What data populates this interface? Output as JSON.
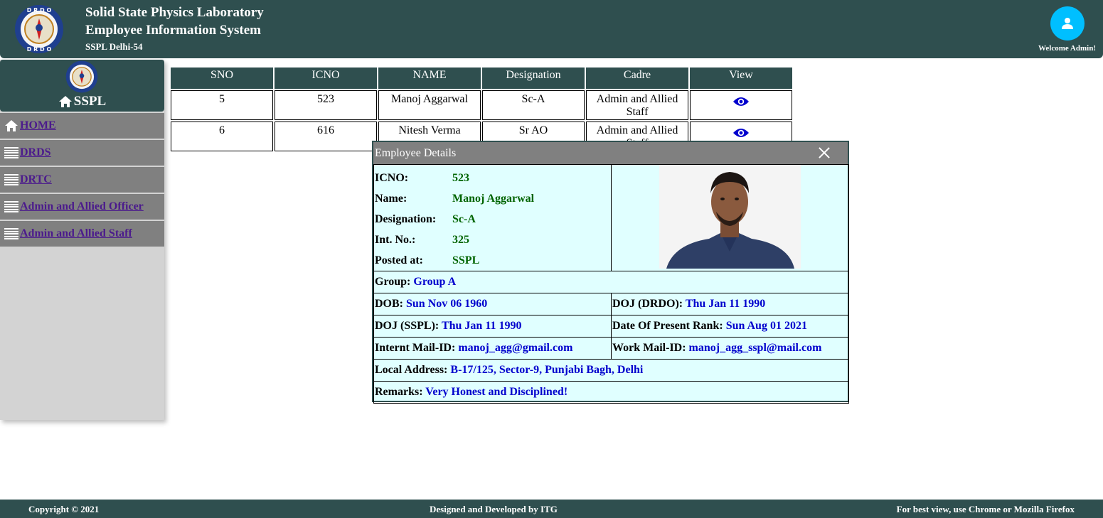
{
  "header": {
    "title_line1": "Solid State Physics Laboratory",
    "title_line2": "Employee Information System",
    "subtitle": "SSPL Delhi-54",
    "welcome": "Welcome Admin!",
    "logo_icon": "drdo-logo-icon",
    "user_icon": "user-icon"
  },
  "sidebar": {
    "title": "SSPL",
    "items": [
      {
        "label": "HOME",
        "icon": "home-icon"
      },
      {
        "label": "DRDS",
        "icon": "menu-icon"
      },
      {
        "label": "DRTC",
        "icon": "menu-icon"
      },
      {
        "label": "Admin and Allied Officer",
        "icon": "menu-icon"
      },
      {
        "label": "Admin and Allied Staff",
        "icon": "menu-icon"
      }
    ]
  },
  "table": {
    "headers": [
      "SNO",
      "ICNO",
      "NAME",
      "Designation",
      "Cadre",
      "View"
    ],
    "rows": [
      {
        "sno": "5",
        "icno": "523",
        "name": "Manoj Aggarwal",
        "designation": "Sc-A",
        "cadre": "Admin and Allied Staff"
      },
      {
        "sno": "6",
        "icno": "616",
        "name": "Nitesh Verma",
        "designation": "Sr AO",
        "cadre": "Admin and Allied Staff"
      }
    ]
  },
  "modal": {
    "title": "Employee Details",
    "icno_label": "ICNO:",
    "icno": "523",
    "name_label": "Name:",
    "name": "Manoj Aggarwal",
    "designation_label": "Designation:",
    "designation": "Sc-A",
    "intno_label": "Int. No.:",
    "intno": "325",
    "posted_label": "Posted at:",
    "posted": "SSPL",
    "group_label": "Group:",
    "group": "Group A",
    "dob_label": "DOB:",
    "dob": "Sun Nov 06 1960",
    "doj_drdo_label": "DOJ (DRDO):",
    "doj_drdo": "Thu Jan 11 1990",
    "doj_sspl_label": "DOJ (SSPL):",
    "doj_sspl": "Thu Jan 11 1990",
    "present_rank_label": "Date Of Present Rank:",
    "present_rank": "Sun Aug 01 2021",
    "internet_mail_label": "Internt Mail-ID:",
    "internet_mail": "manoj_agg@gmail.com",
    "work_mail_label": "Work Mail-ID:",
    "work_mail": "manoj_agg_sspl@mail.com",
    "address_label": "Local Address:",
    "address": "B-17/125, Sector-9, Punjabi Bagh, Delhi",
    "remarks_label": "Remarks:",
    "remarks": "Very Honest and Disciplined!"
  },
  "footer": {
    "copyright": "Copyright © 2021",
    "designed": "Designed and Developed by ITG",
    "best_view": "For best view, use Chrome or Mozilla Firefox"
  },
  "colors": {
    "primary": "#2f4f4f",
    "nav_bg": "#808080",
    "modal_bg": "#e0ffff",
    "value_blue": "#0000cd",
    "value_green": "#006400",
    "view_icon": "#0000cd",
    "avatar": "#00bfff"
  }
}
